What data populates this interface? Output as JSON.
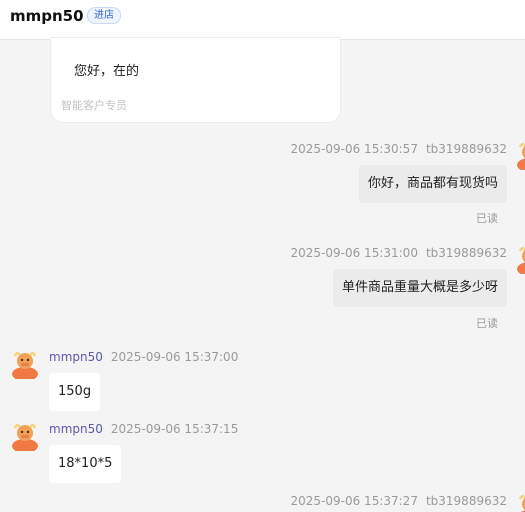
{
  "header": {
    "title": "mmpn50",
    "badge": "进店"
  },
  "pinned": {
    "text": "您好，在的",
    "footer": "智能客户专员"
  },
  "messages": [
    {
      "direction": "out",
      "timestamp": "2025-09-06 15:30:57",
      "sender": "tb319889632",
      "text": "你好，商品都有现货吗",
      "status": "已读"
    },
    {
      "direction": "out",
      "timestamp": "2025-09-06 15:31:00",
      "sender": "tb319889632",
      "text": "单件商品重量大概是多少呀",
      "status": "已读"
    },
    {
      "direction": "in",
      "timestamp": "2025-09-06 15:37:00",
      "sender": "mmpn50",
      "text": "150g"
    },
    {
      "direction": "in",
      "timestamp": "2025-09-06 15:37:15",
      "sender": "mmpn50",
      "text": "18*10*5"
    },
    {
      "direction": "out",
      "timestamp": "2025-09-06 15:37:27",
      "sender": "tb319889632",
      "text": ""
    }
  ],
  "icons": {
    "seller_avatar": "cartoon-cow-avatar",
    "buyer_avatar": "cartoon-cow-avatar"
  },
  "colors": {
    "badge_text": "#2f6bd8",
    "sender_name": "#5a5aa8",
    "avatar_orange": "#f07a42"
  }
}
